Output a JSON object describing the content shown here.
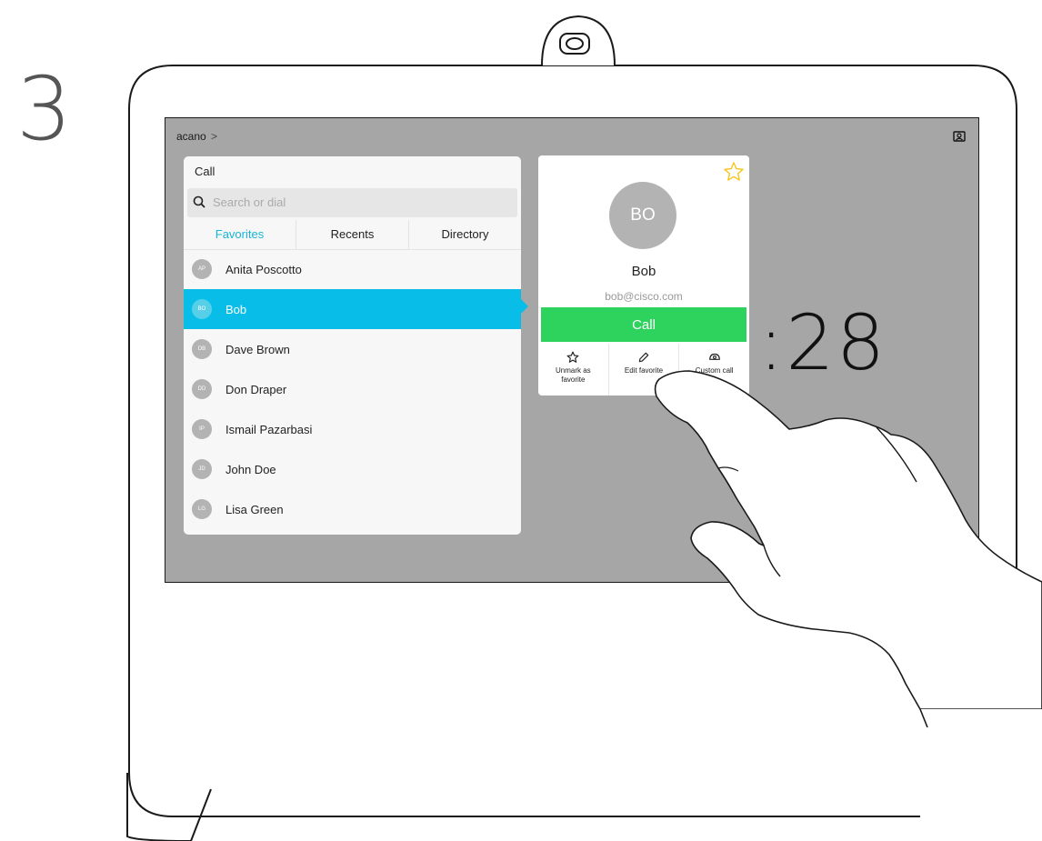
{
  "step": {
    "number": "3"
  },
  "topbar": {
    "title": "acano",
    "chevron": ">",
    "selfview_icon": "selfview-icon"
  },
  "call_panel": {
    "title": "Call",
    "search": {
      "placeholder": "Search or dial",
      "value": ""
    },
    "tabs": [
      {
        "label": "Favorites",
        "active": true
      },
      {
        "label": "Recents",
        "active": false
      },
      {
        "label": "Directory",
        "active": false
      }
    ],
    "contacts": [
      {
        "initials": "AP",
        "name": "Anita Poscotto",
        "selected": false
      },
      {
        "initials": "BO",
        "name": "Bob",
        "selected": true
      },
      {
        "initials": "DB",
        "name": "Dave Brown",
        "selected": false
      },
      {
        "initials": "DD",
        "name": "Don Draper",
        "selected": false
      },
      {
        "initials": "IP",
        "name": "Ismail Pazarbasi",
        "selected": false
      },
      {
        "initials": "JD",
        "name": "John Doe",
        "selected": false
      },
      {
        "initials": "LG",
        "name": "Lisa Green",
        "selected": false
      }
    ]
  },
  "detail": {
    "initials": "BO",
    "name": "Bob",
    "email": "bob@cisco.com",
    "call_label": "Call",
    "actions": [
      {
        "icon": "star-icon",
        "line1": "Unmark as",
        "line2": "favorite"
      },
      {
        "icon": "pencil-icon",
        "line1": "Edit favorite",
        "line2": ""
      },
      {
        "icon": "custom-call-icon",
        "line1": "Custom call",
        "line2": ""
      }
    ]
  },
  "clock": {
    "text": ":28"
  },
  "colors": {
    "accent": "#08bde8",
    "call_green": "#2ed35e",
    "favorites_tab": "#19b5d6",
    "star": "#f5c518",
    "screen_bg": "#a6a6a6"
  }
}
